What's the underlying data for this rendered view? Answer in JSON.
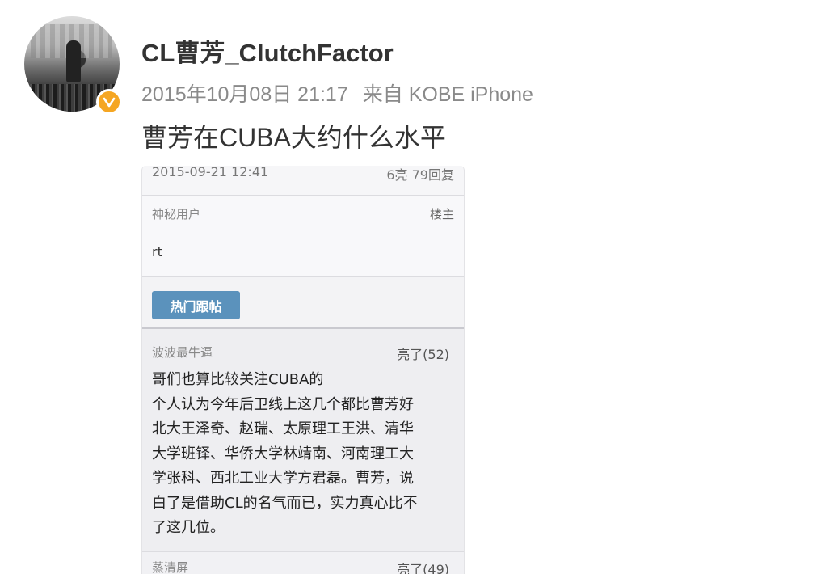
{
  "post": {
    "username": "CL曹芳_ClutchFactor",
    "timestamp": "2015年10月08日 21:17",
    "source": "来自 KOBE iPhone",
    "text": "曹芳在CUBA大约什么水平"
  },
  "screenshot": {
    "thread_date": "2015-09-21 12:41",
    "thread_stats": "6亮 79回复",
    "op_name": "神秘用户",
    "op_tag": "楼主",
    "op_body": "rt",
    "hot_button": "热门跟帖",
    "reply1": {
      "name": "波波最牛逼",
      "likes": "亮了(52)",
      "lines": [
        "哥们也算比较关注CUBA的",
        "个人认为今年后卫线上这几个都比曹芳好",
        "北大王泽奇、赵瑞、太原理工王洪、清华",
        "大学班铎、华侨大学林靖南、河南理工大",
        "学张科、西北工业大学方君磊。曹芳，说",
        "白了是借助CL的名气而已，实力真心比不",
        "了这几位。"
      ]
    },
    "reply2": {
      "name": "蒸清屏",
      "likes": "亮了(49)"
    }
  },
  "colors": {
    "verified_badge": "#f5a623",
    "hot_button": "#5b92bc",
    "meta_text": "#8a8a8a"
  }
}
